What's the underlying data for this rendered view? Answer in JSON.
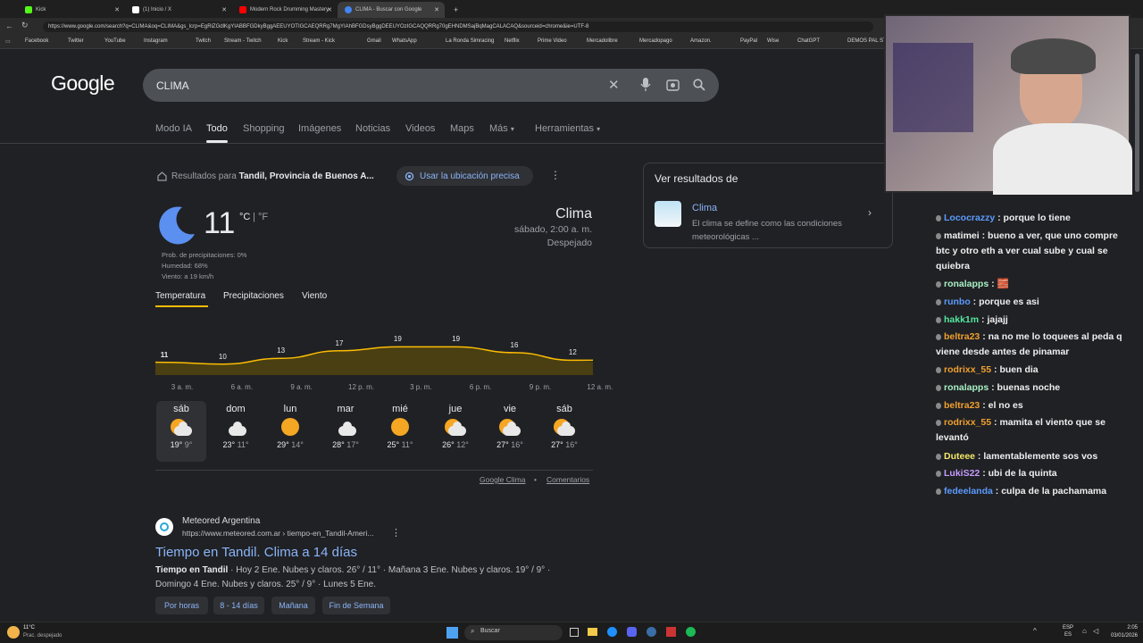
{
  "browser": {
    "tabs": [
      {
        "label": "Kick",
        "color": "#53fc18"
      },
      {
        "label": "(1) Inicio / X",
        "color": "#ffffff"
      },
      {
        "label": "Modern Rock Drumming Mastery",
        "color": "#ff0000"
      },
      {
        "label": "CLIMA - Buscar con Google",
        "color": "#4285f4"
      }
    ],
    "url": "https://www.google.com/search?q=CLIMA&oq=CLIMA&gs_lcrp=EgRlZGdlKgYIABBFGDkyBggAEEUYOTIGCAEQRRg7MgYIAhBFGDsyBggDEEUYOzIGCAQQRRg70gEHNDMSajBqMagCALACAQ&sourceid=chrome&ie=UTF-8",
    "bookmarks": [
      "Facebook",
      "Twitter",
      "YouTube",
      "Instagram",
      "Twitch",
      "Stream - Twitch",
      "Kick",
      "Stream - Kick",
      "Gmail",
      "WhatsApp",
      "La Ronda Simracing",
      "Netflix",
      "Prime Video",
      "Mercadolibre",
      "Mercadopago",
      "Amazon.",
      "PayPal",
      "Wise",
      "ChatGPT",
      "DEMOS PAL ST"
    ]
  },
  "google": {
    "logo": "Google",
    "query": "CLIMA",
    "nav": [
      "Modo IA",
      "Todo",
      "Shopping",
      "Imágenes",
      "Noticias",
      "Videos",
      "Maps",
      "Más",
      "Herramientas"
    ],
    "location_prefix": "Resultados para",
    "location": "Tandil, Provincia de Buenos A...",
    "use_location": "Usar la ubicación precisa"
  },
  "weather": {
    "temp": "11",
    "unit_c": "°C",
    "unit_sep": "|",
    "unit_f": "°F",
    "precip": "Prob. de precipitaciones: 0%",
    "humidity": "Humedad: 68%",
    "wind": "Viento: a 19 km/h",
    "title": "Clima",
    "datetime": "sábado, 2:00 a. m.",
    "condition": "Despejado",
    "tabs": [
      "Temperatura",
      "Precipitaciones",
      "Viento"
    ],
    "hours": [
      "3 a. m.",
      "6 a. m.",
      "9 a. m.",
      "12 p. m.",
      "3 p. m.",
      "6 p. m.",
      "9 p. m.",
      "12 a. m."
    ],
    "hour_temps": [
      11,
      10,
      13,
      17,
      19,
      19,
      16,
      12
    ],
    "days": [
      {
        "name": "sáb",
        "hi": "19°",
        "lo": "9°",
        "icon": "partly-cloudy"
      },
      {
        "name": "dom",
        "hi": "23°",
        "lo": "11°",
        "icon": "cloudy"
      },
      {
        "name": "lun",
        "hi": "29°",
        "lo": "14°",
        "icon": "sunny"
      },
      {
        "name": "mar",
        "hi": "28°",
        "lo": "17°",
        "icon": "cloudy"
      },
      {
        "name": "mié",
        "hi": "25°",
        "lo": "11°",
        "icon": "sunny"
      },
      {
        "name": "jue",
        "hi": "26°",
        "lo": "12°",
        "icon": "partly-cloudy"
      },
      {
        "name": "vie",
        "hi": "27°",
        "lo": "16°",
        "icon": "partly-cloudy"
      },
      {
        "name": "sáb",
        "hi": "27°",
        "lo": "16°",
        "icon": "partly-cloudy"
      }
    ],
    "source": "Google Clima",
    "dot": "•",
    "feedback": "Comentarios"
  },
  "result": {
    "site": "Meteored Argentina",
    "cite": "https://www.meteored.com.ar › tiempo-en_Tandil-Ameri...",
    "title": "Tiempo en Tandil. Clima a 14 días",
    "snippet_bold": "Tiempo en Tandil",
    "snippet": " · Hoy 2 Ene. Nubes y claros. 26° / 11° · Mañana 3 Ene. Nubes y claros. 19° / 9° · Domingo 4 Ene. Nubes y claros. 25° / 9° · Lunes 5 Ene.",
    "pills": [
      "Por horas",
      "8 - 14 días",
      "Mañana",
      "Fin de Semana"
    ]
  },
  "side_panel": {
    "header": "Ver resultados de",
    "title": "Clima",
    "desc": "El clima se define como las condiciones meteorológicas ..."
  },
  "chat": [
    {
      "user": "Lococrazzy",
      "color": "#5b9bff",
      "msg": "porque lo tiene"
    },
    {
      "user": "matimei",
      "color": "#f2f2f2",
      "msg": "bueno a ver, que uno compre btc y otro eth a ver cual sube y cual se quiebra"
    },
    {
      "user": "ronalapps",
      "color": "#a8f0c6",
      "msg": "🧱"
    },
    {
      "user": "runbo",
      "color": "#5b9bff",
      "msg": "porque es asi"
    },
    {
      "user": "hakk1m",
      "color": "#53e8a0",
      "msg": "jajajj"
    },
    {
      "user": "beltra23",
      "color": "#f0a030",
      "msg": "na no me lo toquees al peda q viene desde antes de pinamar"
    },
    {
      "user": "rodrixx_55",
      "color": "#f0a030",
      "msg": "buen dia"
    },
    {
      "user": "ronalapps",
      "color": "#a8f0c6",
      "msg": "buenas noche"
    },
    {
      "user": "beltra23",
      "color": "#f0a030",
      "msg": "el no es"
    },
    {
      "user": "rodrixx_55",
      "color": "#f0a030",
      "msg": "mamita el viento que se levantó"
    },
    {
      "user": "Duteee",
      "color": "#f2e86a",
      "msg": "lamentablemente sos vos"
    },
    {
      "user": "LukiS22",
      "color": "#c49cff",
      "msg": "ubi de la quinta"
    },
    {
      "user": "fedeelanda",
      "color": "#5b9bff",
      "msg": "culpa de la pachamama"
    }
  ],
  "taskbar": {
    "weather_temp": "11°C",
    "weather_desc": "Prac. despejado",
    "search": "Buscar",
    "lang1": "ESP",
    "lang2": "ES",
    "time": "2:05",
    "date": "03/01/2026"
  }
}
